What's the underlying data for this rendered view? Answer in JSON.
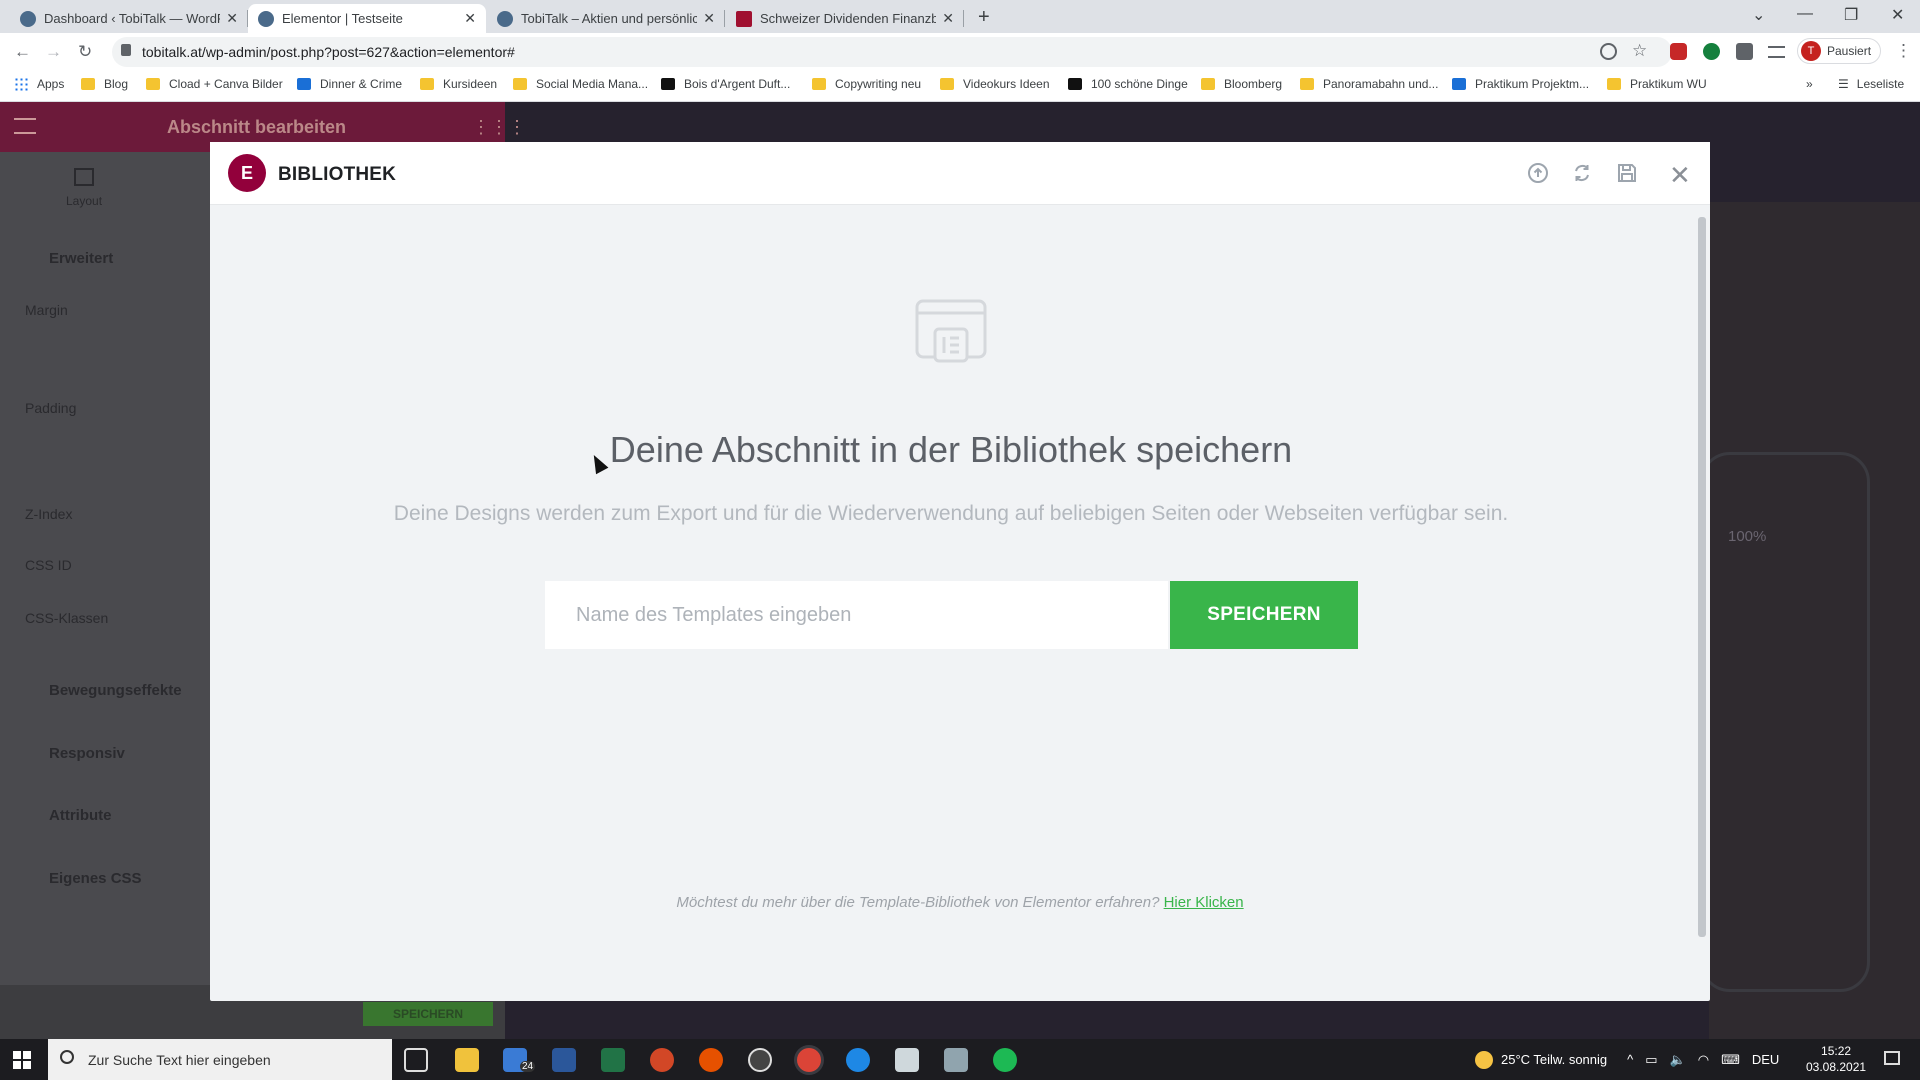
{
  "browser": {
    "tabs": [
      {
        "title": "Dashboard ‹ TobiTalk — WordPress",
        "fav": "#4a6a8a"
      },
      {
        "title": "Elementor | Testseite",
        "fav": "#4a6a8a",
        "active": true
      },
      {
        "title": "TobiTalk – Aktien und persönliche",
        "fav": "#4a6a8a"
      },
      {
        "title": "Schweizer Dividenden Finanzblog",
        "fav": "#a01030"
      }
    ],
    "url": "tobitalk.at/wp-admin/post.php?post=627&action=elementor#",
    "profile_label": "Pausiert",
    "profile_initial": "T",
    "bookmarks": [
      "Apps",
      "Blog",
      "Cload + Canva Bilder",
      "Dinner & Crime",
      "Kursideen",
      "Social Media Mana...",
      "Bois d'Argent Duft...",
      "Copywriting neu",
      "Videokurs Ideen",
      "100 schöne Dinge",
      "Bloomberg",
      "Panoramabahn und...",
      "Praktikum Projektm...",
      "Praktikum WU"
    ],
    "more_bookmarks": "»",
    "reading_list": "Leseliste"
  },
  "editor": {
    "panel_title": "Abschnitt bearbeiten",
    "layout_label": "Layout",
    "section_advanced": "Erweitert",
    "margin": "Margin",
    "padding": "Padding",
    "zindex": "Z-Index",
    "css_id": "CSS ID",
    "css_classes": "CSS-Klassen",
    "motion": "Bewegungseffekte",
    "responsive": "Responsiv",
    "attributes": "Attribute",
    "custom_css": "Eigenes CSS",
    "footer_save": "SPEICHERN",
    "preview_battery": "100%"
  },
  "modal": {
    "logo": "E",
    "title": "BIBLIOTHEK",
    "heading": "Deine Abschnitt in der Bibliothek speichern",
    "description": "Deine Designs werden zum Export und für die Wiederverwendung auf beliebigen Seiten oder Webseiten verfügbar sein.",
    "input_placeholder": "Name des Templates eingeben",
    "save_button": "SPEICHERN",
    "footer_text": "Möchtest du mehr über die Template-Bibliothek von Elementor erfahren?",
    "footer_link": "Hier Klicken"
  },
  "taskbar": {
    "search_placeholder": "Zur Suche Text hier eingeben",
    "mail_badge": "24",
    "weather": "25°C  Teilw. sonnig",
    "language": "DEU",
    "time": "15:22",
    "date": "03.08.2021"
  },
  "colors": {
    "elementor_brand": "#92003b",
    "save_green": "#39b54a"
  }
}
